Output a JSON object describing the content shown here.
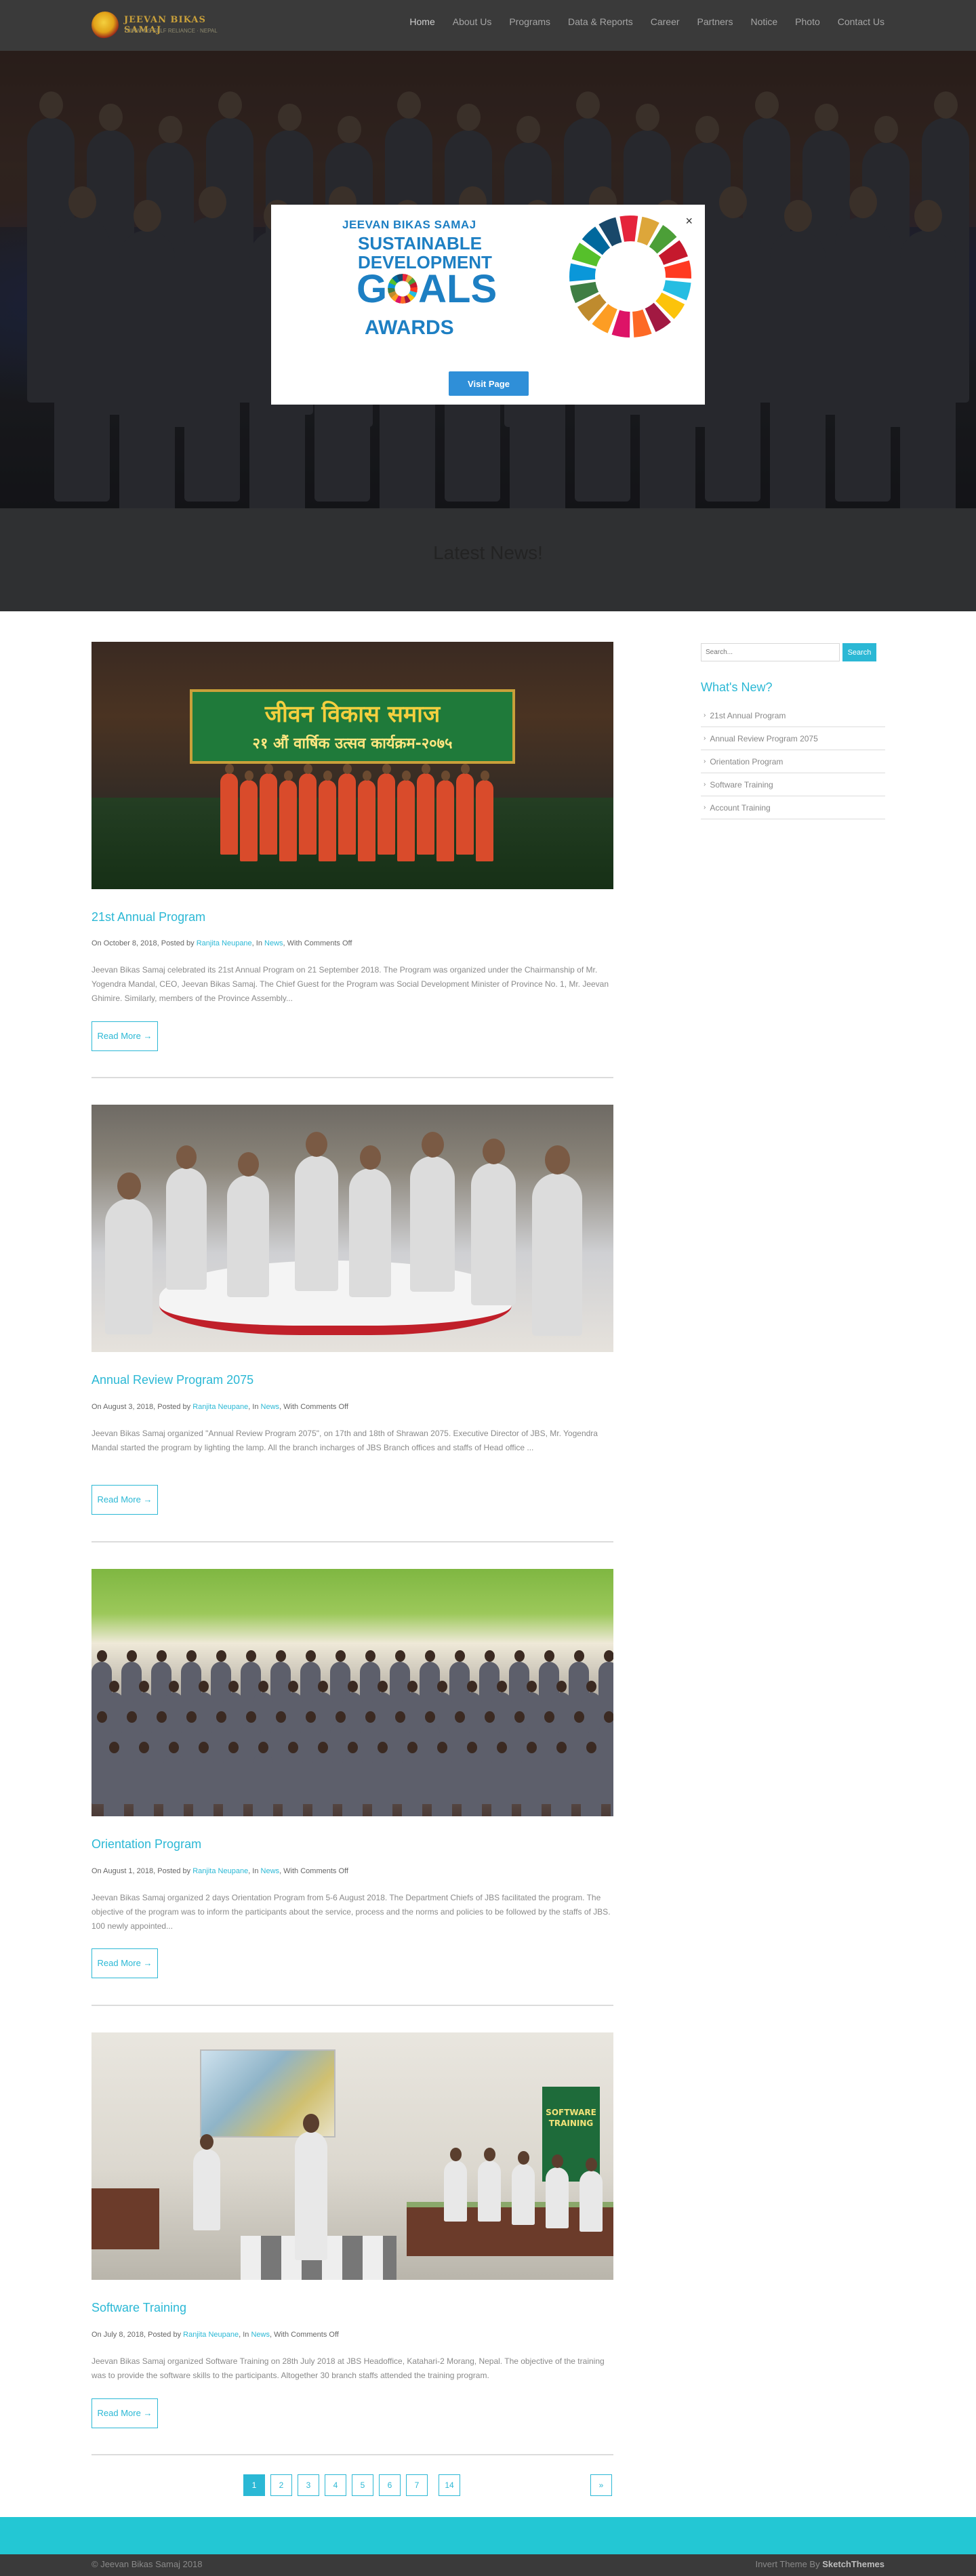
{
  "site": {
    "logo_name": "JEEVAN BIKAS SAMAJ",
    "logo_tagline": "TOWARDS SELF RELIANCE · NEPAL"
  },
  "nav": {
    "items": [
      "Home",
      "About Us",
      "Programs",
      "Data & Reports",
      "Career",
      "Partners",
      "Notice",
      "Photo",
      "Contact Us"
    ]
  },
  "banner": {
    "title": "Latest News!"
  },
  "popup": {
    "close_glyph": "×",
    "org": "JEEVAN BIKAS SAMAJ",
    "line1": "SUSTAINABLE",
    "line2": "DEVELOPMENT",
    "goals_g": "G",
    "goals_als": "ALS",
    "awards": "AWARDS",
    "button_label": "Visit Page",
    "wheel_colors": [
      "#e5243b",
      "#dda63a",
      "#4c9f38",
      "#c5192d",
      "#ff3a21",
      "#26bde2",
      "#fcc30b",
      "#a21942",
      "#fd6925",
      "#dd1367",
      "#fd9d24",
      "#bf8b2e",
      "#3f7e44",
      "#0a97d9",
      "#56c02b",
      "#00689d",
      "#19486a"
    ]
  },
  "posts": [
    {
      "title": "21st Annual Program",
      "meta_prefix": "On October 8, 2018, Posted by",
      "author": "Ranjita Neupane",
      "meta_in": ", In",
      "category": "News",
      "meta_suffix": ", With Comments Off",
      "excerpt": "Jeevan Bikas Samaj celebrated its 21st Annual Program on 21 September 2018. The Program was organized under the Chairmanship of Mr. Yogendra Mandal, CEO, Jeevan Bikas Samaj. The Chief Guest for the Program was Social Development Minister of Province No. 1, Mr. Jeevan Ghimire. Similarly, members of the Province Assembly...",
      "read_more": "Read More →",
      "photo_banner_text": "जीवन विकास समाज",
      "photo_banner_sub": "२१ औं वार्षिक उत्सव कार्यक्रम-२०७५"
    },
    {
      "title": "Annual Review Program 2075",
      "meta_prefix": "On August 3, 2018, Posted by",
      "author": "Ranjita Neupane",
      "meta_in": ", In",
      "category": "News",
      "meta_suffix": ", With Comments Off",
      "excerpt": "Jeevan Bikas Samaj organized \"Annual Review Program 2075\", on 17th and 18th of Shrawan 2075. Executive Director of JBS, Mr. Yogendra Mandal started the program by lighting the lamp. All the branch incharges of JBS Branch offices and staffs of Head office ...",
      "read_more": "Read More →"
    },
    {
      "title": "Orientation Program",
      "meta_prefix": "On August 1, 2018, Posted by",
      "author": "Ranjita Neupane",
      "meta_in": ", In",
      "category": "News",
      "meta_suffix": ", With Comments Off",
      "excerpt": "Jeevan Bikas Samaj organized 2 days Orientation Program from 5-6 August 2018. The Department Chiefs of JBS facilitated the program. The objective of the program was to inform the participants about the service, process and the norms and policies to be followed by the staffs of JBS. 100 newly appointed...",
      "read_more": "Read More →"
    },
    {
      "title": "Software Training",
      "meta_prefix": "On July 8, 2018, Posted by",
      "author": "Ranjita Neupane",
      "meta_in": ", In",
      "category": "News",
      "meta_suffix": ", With Comments Off",
      "excerpt": "Jeevan Bikas Samaj organized Software Training on 28th July 2018 at JBS Headoffice, Katahari-2 Morang, Nepal. The objective of the training was to provide the software skills to the participants. Altogether 30 branch staffs attended the training program.",
      "read_more": "Read More →",
      "photo_banner_text": "SOFTWARE TRAINING"
    }
  ],
  "sidebar": {
    "search_placeholder": "Search...",
    "search_button": "Search",
    "title": "What's New?",
    "items": [
      "21st Annual Program",
      "Annual Review Program 2075",
      "Orientation Program",
      "Software Training",
      "Account Training"
    ]
  },
  "pagination": {
    "pages": [
      "1",
      "2",
      "3",
      "4",
      "5",
      "6",
      "7",
      "14"
    ],
    "next": "»"
  },
  "footer": {
    "copyright": "© Jeevan Bikas Samaj 2018",
    "credit_prefix": "Invert Theme By",
    "credit_name": "SketchThemes"
  }
}
